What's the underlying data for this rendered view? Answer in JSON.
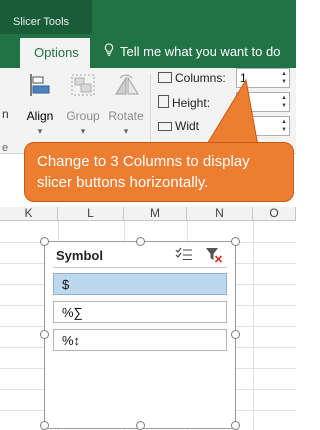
{
  "tabs": {
    "context_title": "Slicer Tools",
    "options": "Options",
    "tellme": "Tell me what you want to do"
  },
  "ribbon": {
    "left_fragment": "n",
    "align_label": "Align",
    "group_label": "Group",
    "rotate_label": "Rotate",
    "columns_label": "Columns:",
    "columns_value": "1",
    "height_label": "Height:",
    "width_label": "Widt",
    "group_caption_fragment": "e"
  },
  "grid": {
    "columns": [
      "K",
      "L",
      "M",
      "N",
      "O"
    ]
  },
  "slicer": {
    "title": "Symbol",
    "items": [
      {
        "label": "$",
        "selected": true
      },
      {
        "label": "%∑",
        "selected": false
      },
      {
        "label": "%↕",
        "selected": false
      }
    ]
  },
  "callout": {
    "text": "Change to 3 Columns to display slicer buttons horizontally."
  },
  "colors": {
    "excel_green": "#217346",
    "callout_orange": "#ed7d31",
    "selected_item": "#bdd7ee"
  }
}
